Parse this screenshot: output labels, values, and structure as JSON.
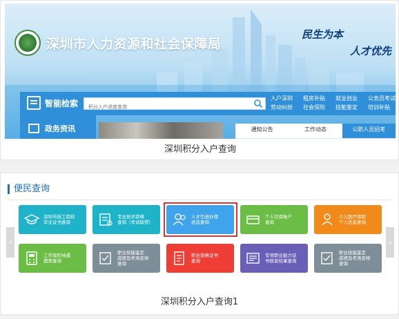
{
  "banner": {
    "org_name": "深圳市人力资源和社会保障局",
    "slogan_line1": "民生为本",
    "slogan_line2": "人才优先",
    "search_label": "智能检索",
    "search_placeholder": "积分入户进度查询",
    "quick_links": [
      "入户深圳",
      "租房补贴",
      "就业创业",
      "公务员考试",
      "劳动纠纷",
      "社会保险",
      "技能鉴定",
      "培训补贴"
    ],
    "leftnav_label": "政务资讯",
    "news_tabs": [
      "通知公告",
      "工作动态",
      "公职人员招考"
    ]
  },
  "caption1": "深圳积分入户查询",
  "panel": {
    "title": "便民查询",
    "tiles_row1": [
      {
        "label": "深圳市技工院校\n毕业证书查询",
        "color": "#1fb3c9",
        "icon": "graduation-cap-icon"
      },
      {
        "label": "专业技术资格\n查询（考试取得）",
        "color": "#1fb3c9",
        "icon": "certificate-icon"
      },
      {
        "label": "人才引进办理\n状态查询",
        "color": "#3fa4ec",
        "icon": "users-icon"
      },
      {
        "label": "个人社保账户\n查询",
        "color": "#6cbd45",
        "icon": "card-icon"
      },
      {
        "label": "少儿医疗保险\n个人信息查询",
        "color": "#f08a1a",
        "icon": "child-medical-icon"
      }
    ],
    "tiles_row2": [
      {
        "label": "工作保险待遇\n费率查询",
        "color": "#6cbd45",
        "icon": "calculator-icon"
      },
      {
        "label": "职业技能鉴定\n成绩及考场安排\n查询",
        "color": "#7e8e99",
        "icon": "checklist-icon"
      },
      {
        "label": "职业资格证书\n查询",
        "color": "#ef3e36",
        "icon": "document-icon"
      },
      {
        "label": "专项职业能力证\n书核发结果查询",
        "color": "#6a5fb6",
        "icon": "newspaper-icon"
      },
      {
        "label": "职业技能鉴定\n成绩及考场安排\n查询",
        "color": "#7e8e99",
        "icon": "checklist-icon"
      }
    ]
  },
  "caption2": "深圳积分入户查询1",
  "colors": {
    "primary": "#2f8fd8",
    "highlight": "#e0322f"
  }
}
